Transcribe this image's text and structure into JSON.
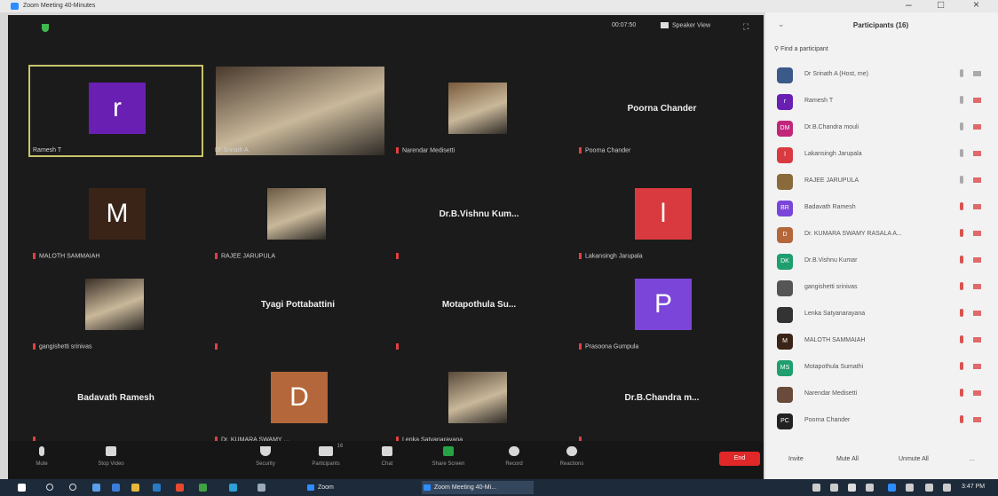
{
  "window": {
    "title": "Zoom Meeting 40-Minutes"
  },
  "meeting": {
    "timer": "00:07:50",
    "view_label": "Speaker View",
    "tiles": [
      {
        "name": "Ramesh T",
        "kind": "avatar",
        "letter": "r",
        "color": "#6a1fb3",
        "active": true
      },
      {
        "name": "Dr Srinath A",
        "kind": "photo"
      },
      {
        "name": "Narendar Medisetti",
        "kind": "photo"
      },
      {
        "name": "Poorna Chander",
        "kind": "name",
        "bigname": "Poorna Chander"
      },
      {
        "name": "MALOTH SAMMAIAH",
        "kind": "avatar",
        "letter": "M",
        "color": "#3a2418"
      },
      {
        "name": "RAJEE JARUPULA",
        "kind": "photo"
      },
      {
        "name": "",
        "kind": "name",
        "bigname": "Dr.B.Vishnu  Kum..."
      },
      {
        "name": "Lakansingh Jarupala",
        "kind": "avatar",
        "letter": "l",
        "color": "#d93a3f"
      },
      {
        "name": "gangishetti srinivas",
        "kind": "photo"
      },
      {
        "name": "",
        "kind": "name",
        "bigname": "Tyagi Pottabattini"
      },
      {
        "name": "",
        "kind": "name",
        "bigname": "Motapothula  Su..."
      },
      {
        "name": "Prasoona Gumpula",
        "kind": "avatar",
        "letter": "P",
        "color": "#7a45d8"
      },
      {
        "name": "",
        "kind": "name",
        "bigname": "Badavath Ramesh"
      },
      {
        "name": "Dr. KUMARA SWAMY ...",
        "kind": "avatar",
        "letter": "D",
        "color": "#b4673a"
      },
      {
        "name": "Lenka Satyanarayana",
        "kind": "photo"
      },
      {
        "name": "",
        "kind": "name",
        "bigname": "Dr.B.Chandra  m..."
      }
    ]
  },
  "toolbar": {
    "mute": "Mute",
    "stop_video": "Stop Video",
    "security": "Security",
    "participants": "Participants",
    "participants_count": "16",
    "chat": "Chat",
    "share_screen": "Share Screen",
    "record": "Record",
    "reactions": "Reactions",
    "end": "End"
  },
  "participants_panel": {
    "title": "Participants (16)",
    "search_placeholder": "Find a participant",
    "list": [
      {
        "name": "Dr Srinath A (Host, me)",
        "initials": "",
        "color": "#3b5a8a",
        "mic_muted": false,
        "cam_off": false
      },
      {
        "name": "Ramesh T",
        "initials": "r",
        "color": "#6a1fb3",
        "mic_muted": false,
        "cam_off": true
      },
      {
        "name": "Dr.B.Chandra mouli",
        "initials": "DM",
        "color": "#c0267a",
        "mic_muted": false,
        "cam_off": true
      },
      {
        "name": "Lakansingh Jarupala",
        "initials": "l",
        "color": "#d93a3f",
        "mic_muted": false,
        "cam_off": true
      },
      {
        "name": "RAJEE JARUPULA",
        "initials": "",
        "color": "#8a6a3a",
        "mic_muted": false,
        "cam_off": true
      },
      {
        "name": "Badavath Ramesh",
        "initials": "BR",
        "color": "#7a45d8",
        "mic_muted": true,
        "cam_off": true
      },
      {
        "name": "Dr. KUMARA SWAMY RASALA A...",
        "initials": "D",
        "color": "#b4673a",
        "mic_muted": true,
        "cam_off": true
      },
      {
        "name": "Dr.B.Vishnu Kumar",
        "initials": "DK",
        "color": "#1f9e6e",
        "mic_muted": true,
        "cam_off": true
      },
      {
        "name": "gangishetti srinivas",
        "initials": "",
        "color": "#555555",
        "mic_muted": true,
        "cam_off": true
      },
      {
        "name": "Lenka Satyanarayana",
        "initials": "",
        "color": "#333333",
        "mic_muted": true,
        "cam_off": true
      },
      {
        "name": "MALOTH SAMMAIAH",
        "initials": "M",
        "color": "#3a2418",
        "mic_muted": true,
        "cam_off": true
      },
      {
        "name": "Motapothula Sumathi",
        "initials": "MS",
        "color": "#1f9e6e",
        "mic_muted": true,
        "cam_off": true
      },
      {
        "name": "Narendar Medisetti",
        "initials": "",
        "color": "#6a4a3a",
        "mic_muted": true,
        "cam_off": true
      },
      {
        "name": "Poorna Chander",
        "initials": "PC",
        "color": "#222222",
        "mic_muted": true,
        "cam_off": true
      }
    ],
    "invite": "Invite",
    "mute_all": "Mute All",
    "unmute_all": "Unmute All",
    "more": "..."
  },
  "taskbar": {
    "zoom_app": "Zoom",
    "meeting_app": "Zoom Meeting 40-Mi...",
    "clock": "3:47 PM"
  }
}
